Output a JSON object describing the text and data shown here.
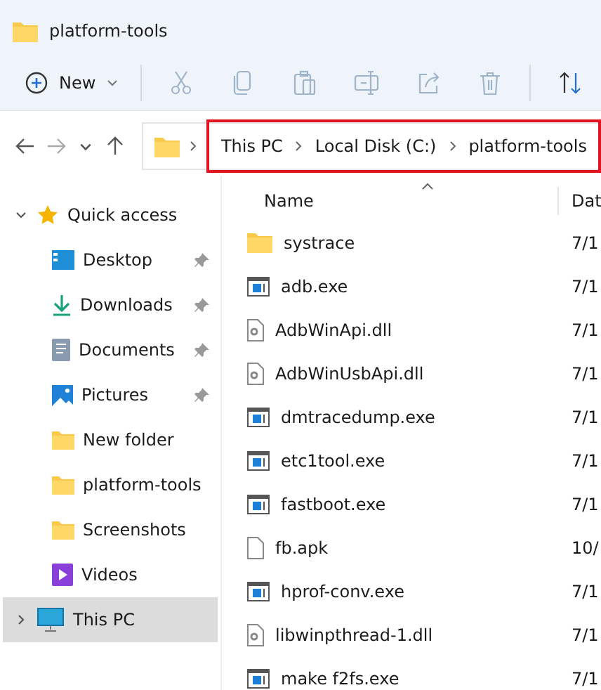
{
  "window": {
    "title": "platform-tools"
  },
  "toolbar": [
    {
      "kind": "new",
      "label": "New"
    },
    {
      "kind": "cut",
      "disabled": true
    },
    {
      "kind": "copy",
      "disabled": true
    },
    {
      "kind": "paste",
      "disabled": true
    },
    {
      "kind": "rename",
      "disabled": true
    },
    {
      "kind": "share",
      "disabled": true
    },
    {
      "kind": "delete",
      "disabled": true
    },
    {
      "kind": "sort"
    }
  ],
  "navigation": [
    {
      "kind": "back",
      "disabled": false
    },
    {
      "kind": "forward",
      "disabled": true
    },
    {
      "kind": "recent",
      "disabled": false
    },
    {
      "kind": "up",
      "disabled": false
    }
  ],
  "address": {
    "highlighted": true,
    "crumbs": [
      "This PC",
      "Local Disk (C:)",
      "platform-tools"
    ]
  },
  "sidebar": {
    "items": [
      {
        "kind": "star",
        "label": "Quick access",
        "expanded": true,
        "selected": false,
        "children": [
          {
            "kind": "desktop",
            "label": "Desktop",
            "pinned": true,
            "selected": false
          },
          {
            "kind": "downloads",
            "label": "Downloads",
            "pinned": true,
            "selected": false
          },
          {
            "kind": "documents",
            "label": "Documents",
            "pinned": true,
            "selected": false
          },
          {
            "kind": "pictures",
            "label": "Pictures",
            "pinned": true,
            "selected": false
          },
          {
            "kind": "folder",
            "label": "New folder",
            "pinned": false,
            "selected": false
          },
          {
            "kind": "folder",
            "label": "platform-tools",
            "pinned": false,
            "selected": false
          },
          {
            "kind": "folder",
            "label": "Screenshots",
            "pinned": false,
            "selected": false
          },
          {
            "kind": "videos",
            "label": "Videos",
            "pinned": false,
            "selected": false
          }
        ]
      },
      {
        "kind": "pc",
        "label": "This PC",
        "expanded": false,
        "selected": true
      }
    ]
  },
  "table": {
    "columns": [
      {
        "label": "Name",
        "sorted": true
      },
      {
        "label": "Dat",
        "sorted": false
      }
    ],
    "rows": [
      {
        "kind": "folder",
        "name": "systrace",
        "date": "7/1"
      },
      {
        "kind": "exe",
        "name": "adb.exe",
        "date": "7/1"
      },
      {
        "kind": "dll",
        "name": "AdbWinApi.dll",
        "date": "7/1"
      },
      {
        "kind": "dll",
        "name": "AdbWinUsbApi.dll",
        "date": "7/1"
      },
      {
        "kind": "exe",
        "name": "dmtracedump.exe",
        "date": "7/1"
      },
      {
        "kind": "exe",
        "name": "etc1tool.exe",
        "date": "7/1"
      },
      {
        "kind": "exe",
        "name": "fastboot.exe",
        "date": "7/1"
      },
      {
        "kind": "file",
        "name": "fb.apk",
        "date": "10/"
      },
      {
        "kind": "exe",
        "name": "hprof-conv.exe",
        "date": "7/1"
      },
      {
        "kind": "dll",
        "name": "libwinpthread-1.dll",
        "date": "7/1"
      },
      {
        "kind": "exe",
        "name": "make f2fs.exe",
        "date": "7/1"
      }
    ]
  }
}
